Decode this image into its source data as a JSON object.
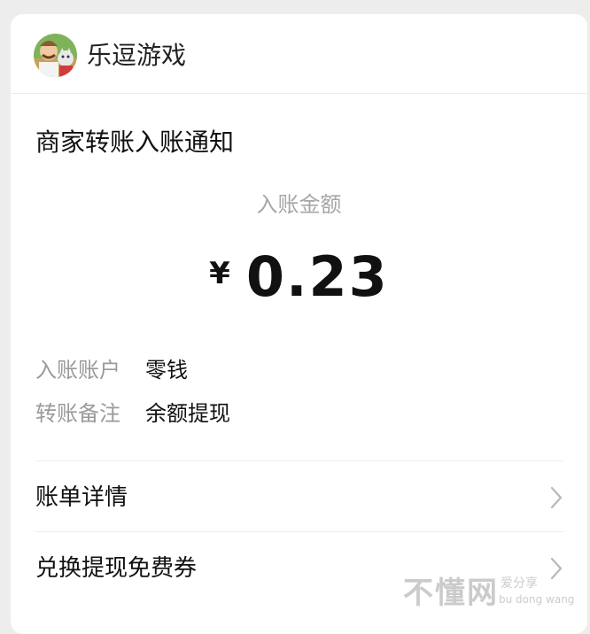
{
  "header": {
    "app_name": "乐逗游戏",
    "avatar_icon": "game-character-avatar-icon"
  },
  "notice": {
    "title": "商家转账入账通知",
    "amount_label": "入账金额",
    "currency_symbol": "¥",
    "amount": "0.23"
  },
  "details": [
    {
      "key": "入账账户",
      "value": "零钱"
    },
    {
      "key": "转账备注",
      "value": "余额提现"
    }
  ],
  "links": [
    {
      "label": "账单详情",
      "icon": "chevron-right-icon"
    },
    {
      "label": "兑换提现免费券",
      "icon": "chevron-right-icon"
    }
  ],
  "watermark": {
    "main": "不懂网",
    "sub1": "爱分享",
    "sub2": "bu dong wang"
  },
  "colors": {
    "background": "#ededed",
    "card": "#ffffff",
    "muted_text": "#9a9a9a",
    "primary_text": "#111111"
  }
}
